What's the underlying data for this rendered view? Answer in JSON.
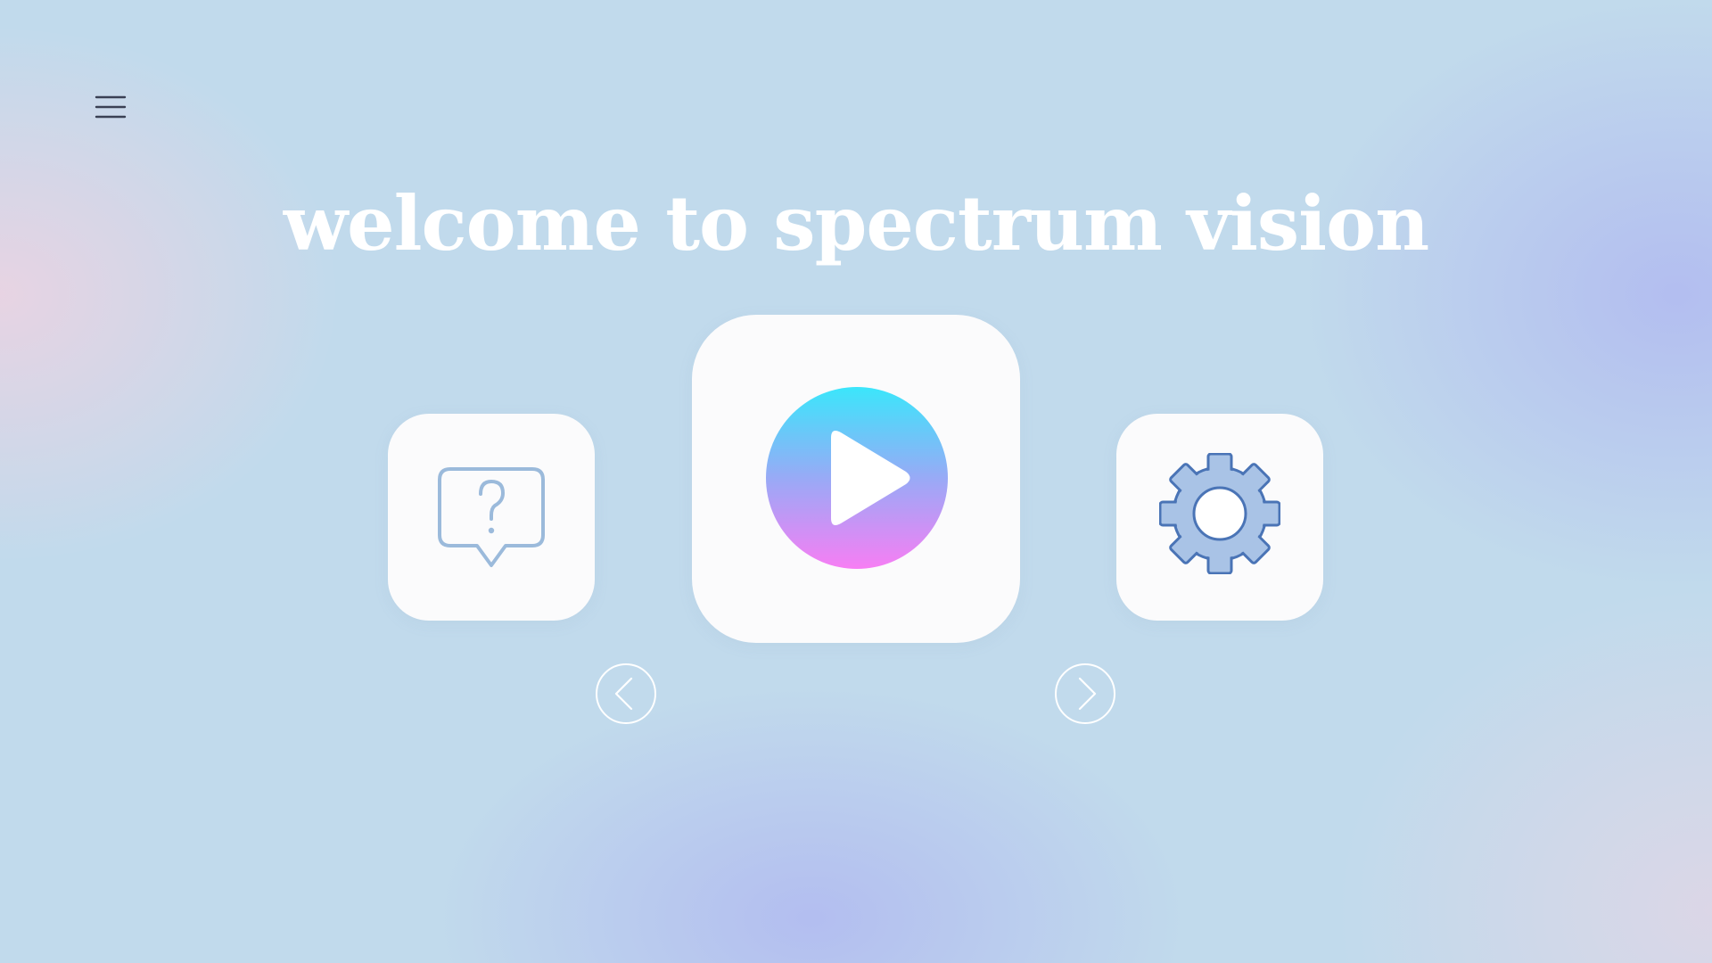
{
  "header": {
    "title": "welcome to spectrum vision",
    "menu_icon": "hamburger-menu-icon"
  },
  "tiles": [
    {
      "id": "help",
      "icon": "help-chat-bubble-icon",
      "color": "#9bbadb"
    },
    {
      "id": "play",
      "icon": "play-icon",
      "gradient": [
        "#3be6fb",
        "#f77ef4"
      ]
    },
    {
      "id": "settings",
      "icon": "gear-icon",
      "color": "#4a74b6",
      "fill": "#a9c3e6"
    }
  ],
  "navigation": {
    "prev_icon": "chevron-left-icon",
    "next_icon": "chevron-right-icon"
  },
  "colors": {
    "background": "#c1daec",
    "tile": "#fbfbfc",
    "title": "#ffffff",
    "menu_icon": "#3a4054"
  }
}
